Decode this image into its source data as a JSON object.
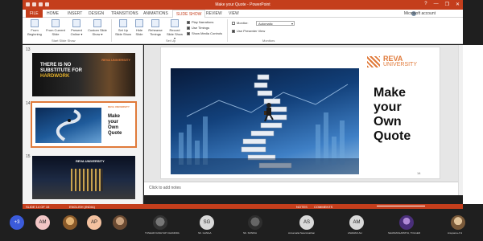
{
  "titlebar": {
    "title": "Make your Quote - PowerPoint",
    "win_controls": [
      "?",
      "—",
      "❐",
      "✕"
    ]
  },
  "tabs": {
    "items": [
      "FILE",
      "HOME",
      "INSERT",
      "DESIGN",
      "TRANSITIONS",
      "ANIMATIONS",
      "SLIDE SHOW",
      "REVIEW",
      "VIEW"
    ],
    "active": "SLIDE SHOW",
    "account": "Microsoft account"
  },
  "ribbon": {
    "start_buttons": [
      "From Beginning",
      "From Current Slide",
      "Present Online ▾",
      "Custom Slide Show ▾"
    ],
    "setup_buttons": [
      "Set Up Slide Show",
      "Hide Slide",
      "Rehearse Timings",
      "Record Slide Show ▾"
    ],
    "checks": [
      {
        "label": "Play Narrations",
        "checked": true
      },
      {
        "label": "Use Timings",
        "checked": true
      },
      {
        "label": "Show Media Controls",
        "checked": true
      }
    ],
    "monitor_label": "Monitor:",
    "monitor_value": "Automatic",
    "presenter_view": "Use Presenter View",
    "groups": [
      "Start Slide Show",
      "Set Up",
      "Monitors"
    ]
  },
  "thumbnails": [
    {
      "num": "13",
      "text_lines": [
        "THERE IS NO",
        "SUBSTITUTE FOR",
        "HARDWORK"
      ],
      "logo": "REVA UNIVERSITY"
    },
    {
      "num": "14",
      "text_lines": [
        "Make",
        "your",
        "Own",
        "Quote"
      ],
      "logo": "REVA UNIVERSITY",
      "selected": true
    },
    {
      "num": "15",
      "logo": "REVA UNIVERSITY"
    }
  ],
  "slide": {
    "logo_line1": "REVA",
    "logo_line2": "UNIVERSITY",
    "heading_lines": [
      "Make",
      "your",
      "Own",
      "Quote"
    ],
    "page_number": "14"
  },
  "notes_placeholder": "Click to add notes",
  "statusbar": {
    "slide_info": "SLIDE 14 OF 15",
    "language": "ENGLISH (INDIA)",
    "notes": "NOTES",
    "comments": "COMMENTS"
  },
  "participants": [
    {
      "initials": "+3",
      "color": "#3b5bdb",
      "name": ""
    },
    {
      "initials": "AM",
      "color": "#f2c6c6",
      "name": ""
    },
    {
      "initials": "AP",
      "color": "#f4c2a0",
      "name": ""
    },
    {
      "initials": "",
      "color": "#8a6a52",
      "name": ""
    },
    {
      "initials": "",
      "color": "#d8a35a",
      "name": ""
    },
    {
      "initials": "",
      "color": "#4a4a4a",
      "name": "TUSHAR KASHYAP CHANDRA"
    },
    {
      "initials": "SG",
      "color": "#d9d9d9",
      "name": "SK. GANGA"
    },
    {
      "initials": "",
      "color": "#4a4a4a",
      "name": "SK. SONIKA"
    },
    {
      "initials": "AS",
      "color": "#d9d9d9",
      "name": "Annamalai Swaminathan"
    },
    {
      "initials": "AM",
      "color": "#d9d9d9",
      "name": "ASHMAN ALI"
    },
    {
      "initials": "",
      "color": "#6d4d9a",
      "name": "SHANMUGAPRIYA, TOLGER"
    },
    {
      "initials": "",
      "color": "#c6a87e",
      "name": "Anupama A S"
    }
  ],
  "colors": {
    "accent": "#c43e1c",
    "reva_orange": "#e07a3a"
  }
}
